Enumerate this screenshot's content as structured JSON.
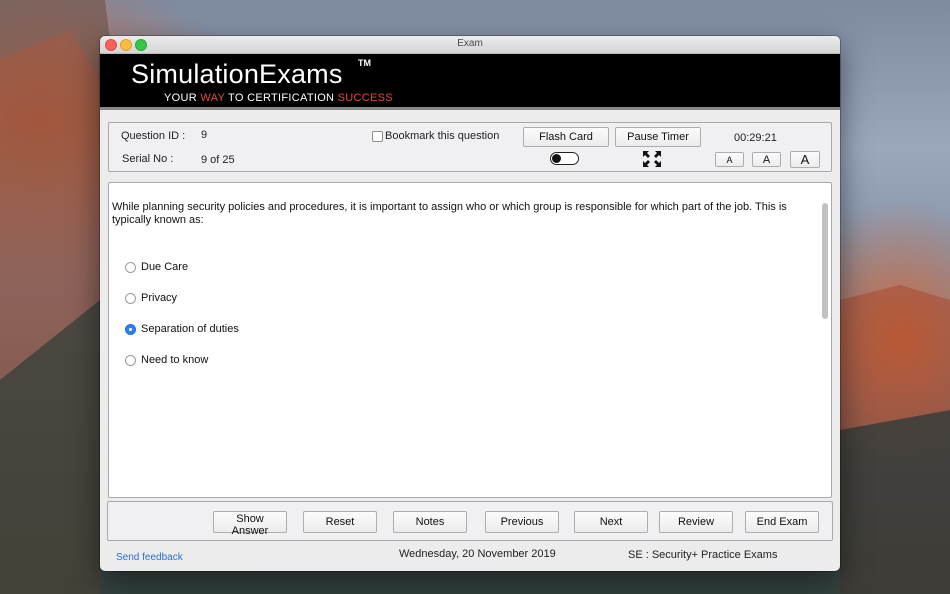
{
  "window": {
    "title": "Exam"
  },
  "banner": {
    "logo": "SimulationExams",
    "trademark": "TM",
    "tagline_part1": "YOUR ",
    "tagline_way": "WAY",
    "tagline_part2": " TO CERTIFICATION ",
    "tagline_success": "SUCCESS"
  },
  "info": {
    "question_id_label": "Question ID :",
    "question_id_value": "9",
    "serial_label": "Serial No :",
    "serial_value": "9 of 25",
    "bookmark_label": "Bookmark this question",
    "flash_card_label": "Flash Card",
    "pause_timer_label": "Pause Timer",
    "timer": "00:29:21",
    "font_small": "A",
    "font_medium": "A",
    "font_large": "A"
  },
  "question": {
    "text": "While planning security policies and procedures, it is important to assign who or which group is responsible for which part of the job. This is typically known as:",
    "options": [
      {
        "label": "Due Care",
        "selected": false
      },
      {
        "label": "Privacy",
        "selected": false
      },
      {
        "label": "Separation of duties",
        "selected": true
      },
      {
        "label": "Need to know",
        "selected": false
      }
    ]
  },
  "actions": {
    "show_answer": "Show Answer",
    "reset": "Reset",
    "notes": "Notes",
    "previous": "Previous",
    "next": "Next",
    "review": "Review",
    "end_exam": "End Exam"
  },
  "footer": {
    "feedback": "Send feedback",
    "date": "Wednesday, 20 November 2019",
    "exam_name": "SE : Security+ Practice Exams"
  },
  "colors": {
    "accent_red": "#e34a3a",
    "radio_selected": "#2a7ff5",
    "link": "#2a6fd6"
  }
}
